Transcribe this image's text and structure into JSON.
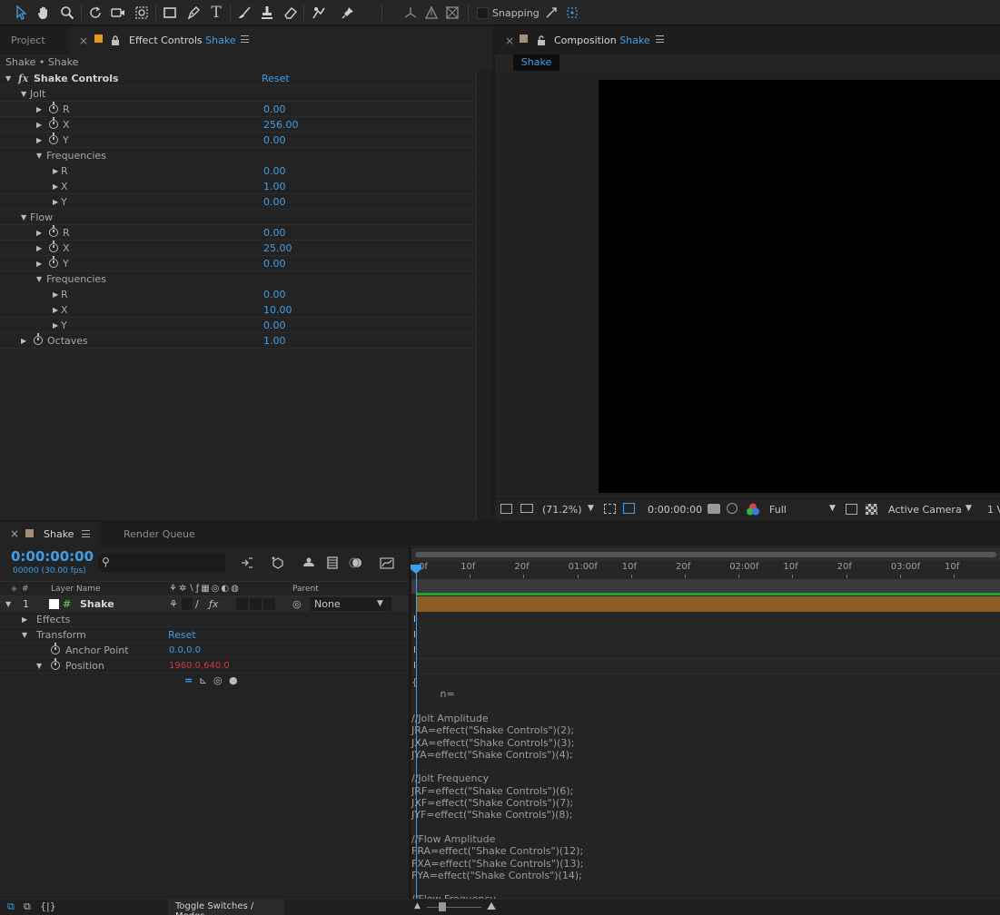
{
  "toolbar": {
    "tools": [
      "selection-tool",
      "hand-tool",
      "zoom-tool",
      "rotation-tool",
      "camera-tool",
      "pan-behind-tool",
      "rectangle-tool",
      "pen-tool",
      "type-tool",
      "brush-tool",
      "clone-stamp-tool",
      "eraser-tool",
      "roto-brush-tool",
      "puppet-pin-tool",
      "local-axis-icon",
      "world-axis-icon",
      "view-axis-icon"
    ],
    "snapping_label": "Snapping"
  },
  "effect_panel": {
    "project_tab": "Project",
    "tab_label": "Effect Controls",
    "tab_layer": "Shake",
    "breadcrumb": "Shake • Shake",
    "effect_name": "Shake Controls",
    "reset_label": "Reset",
    "fx_label": "fx",
    "groups": {
      "jolt": "Jolt",
      "flow": "Flow",
      "frequencies": "Frequencies",
      "octaves": "Octaves"
    },
    "rows": [
      {
        "label": "R",
        "value": "0.00"
      },
      {
        "label": "X",
        "value": "256.00"
      },
      {
        "label": "Y",
        "value": "0.00"
      },
      {
        "label": "R",
        "value": "0.00"
      },
      {
        "label": "X",
        "value": "1.00"
      },
      {
        "label": "Y",
        "value": "0.00"
      },
      {
        "label": "R",
        "value": "0.00"
      },
      {
        "label": "X",
        "value": "25.00"
      },
      {
        "label": "Y",
        "value": "0.00"
      },
      {
        "label": "R",
        "value": "0.00"
      },
      {
        "label": "X",
        "value": "10.00"
      },
      {
        "label": "Y",
        "value": "0.00"
      }
    ],
    "octaves_value": "1.00"
  },
  "composition_panel": {
    "tab_label": "Composition",
    "tab_comp": "Shake",
    "comp_tab": "Shake",
    "zoom": "(71.2%)",
    "timecode": "0:00:00:00",
    "resolution": "Full",
    "camera": "Active Camera",
    "view_count": "1 V"
  },
  "timeline": {
    "tab_label": "Shake",
    "render_queue": "Render Queue",
    "timecode": "0:00:00:00",
    "frame_info": "00000 (30.00 fps)",
    "col_num": "#",
    "col_layer": "Layer Name",
    "col_parent": "Parent",
    "layer_number": "1",
    "layer_name": "Shake",
    "parent_value": "None",
    "effects_label": "Effects",
    "transform_label": "Transform",
    "reset_label": "Reset",
    "anchor_label": "Anchor Point",
    "anchor_value": "0.0,0.0",
    "position_label": "Position",
    "position_value": "1960.0,640.0",
    "toggle_label": "Toggle Switches / Modes",
    "ruler": [
      "0f",
      "10f",
      "20f",
      "01:00f",
      "10f",
      "20f",
      "02:00f",
      "10f",
      "20f",
      "03:00f",
      "10f"
    ],
    "expression_lines": [
      "{",
      "         n=",
      "",
      "//Jolt Amplitude",
      "JRA=effect(\"Shake Controls\")(2);",
      "JXA=effect(\"Shake Controls\")(3);",
      "JYA=effect(\"Shake Controls\")(4);",
      "",
      "//Jolt Frequency",
      "JRF=effect(\"Shake Controls\")(6);",
      "JXF=effect(\"Shake Controls\")(7);",
      "JYF=effect(\"Shake Controls\")(8);",
      "",
      "//Flow Amplitude",
      "FRA=effect(\"Shake Controls\")(12);",
      "FXA=effect(\"Shake Controls\")(13);",
      "FYA=effect(\"Shake Controls\")(14);",
      "",
      "//Flow Frequency"
    ]
  },
  "colors": {
    "accent_blue": "#3f9ee9",
    "layer_bar": "#8a5e22",
    "keyframe_red": "#d0383d",
    "work_area": "#26a23a"
  }
}
